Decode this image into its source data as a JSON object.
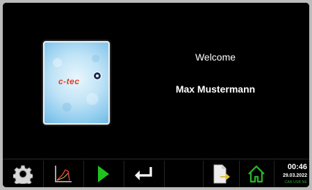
{
  "welcome": {
    "greeting": "Welcome",
    "user_name": "Max Mustermann",
    "logo_text": "c-tec"
  },
  "toolbar": {
    "buttons": [
      {
        "icon": "gear-icon"
      },
      {
        "icon": "graph-icon"
      },
      {
        "icon": "play-icon"
      },
      {
        "icon": "enter-icon"
      },
      {
        "icon": "export-icon"
      },
      {
        "icon": "home-icon"
      }
    ],
    "time": "00:46",
    "date": "29.03.2022",
    "status": "CAN USB NE"
  },
  "colors": {
    "play": "#1fc21f",
    "home": "#27b127",
    "export": "#d8c03a",
    "logo": "#e23a1f"
  }
}
